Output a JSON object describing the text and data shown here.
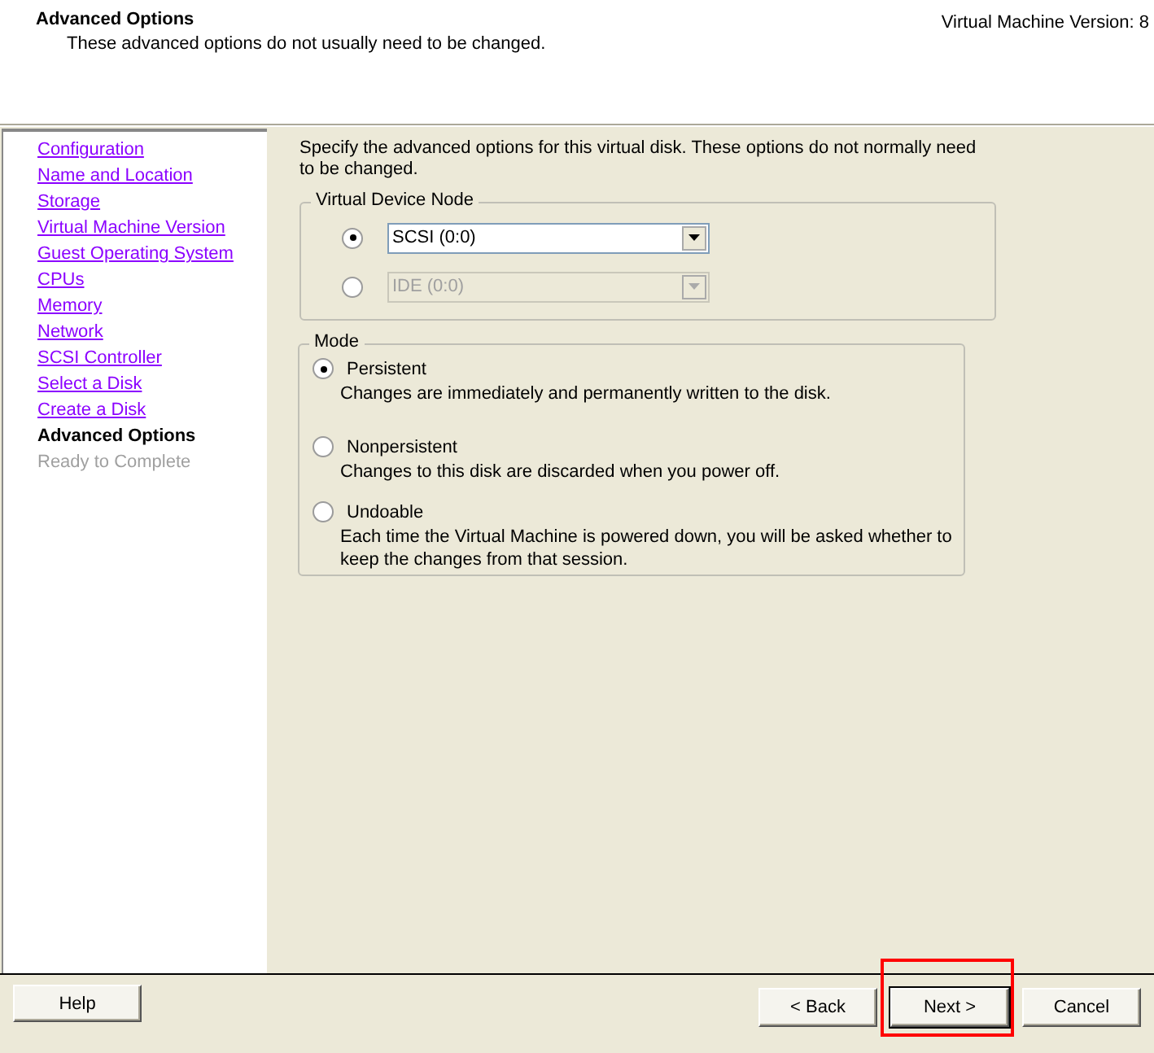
{
  "header": {
    "title": "Advanced Options",
    "subtitle": "These advanced options do not usually need to be changed.",
    "version": "Virtual Machine Version: 8"
  },
  "sidebar": {
    "items": [
      {
        "label": "Configuration",
        "kind": "link"
      },
      {
        "label": "Name and Location",
        "kind": "link"
      },
      {
        "label": "Storage",
        "kind": "link"
      },
      {
        "label": "Virtual Machine Version",
        "kind": "link"
      },
      {
        "label": "Guest Operating System",
        "kind": "link"
      },
      {
        "label": "CPUs",
        "kind": "link"
      },
      {
        "label": "Memory",
        "kind": "link"
      },
      {
        "label": "Network",
        "kind": "link"
      },
      {
        "label": "SCSI Controller",
        "kind": "link"
      },
      {
        "label": "Select a Disk",
        "kind": "link"
      },
      {
        "label": "Create a Disk",
        "kind": "link"
      },
      {
        "label": "Advanced Options",
        "kind": "current"
      },
      {
        "label": "Ready to Complete",
        "kind": "pending"
      }
    ]
  },
  "intro": "Specify the advanced options for this virtual disk. These options do not normally need to be changed.",
  "device_node": {
    "title": "Virtual Device Node",
    "options": [
      {
        "value": "SCSI (0:0)",
        "selected": true,
        "disabled": false
      },
      {
        "value": "IDE (0:0)",
        "selected": false,
        "disabled": true
      }
    ]
  },
  "mode": {
    "title": "Mode",
    "options": [
      {
        "label": "Persistent",
        "description": "Changes are immediately and permanently written to the disk.",
        "selected": true
      },
      {
        "label": "Nonpersistent",
        "description": "Changes to this disk are discarded when you power off.",
        "selected": false
      },
      {
        "label": "Undoable",
        "description": "Each time the Virtual Machine is powered down, you will be asked whether to keep the changes from that session.",
        "selected": false
      }
    ]
  },
  "buttons": {
    "help": "Help",
    "nav": [
      {
        "label": "< Back",
        "highlighted": false
      },
      {
        "label": "Next >",
        "highlighted": true
      },
      {
        "label": "Cancel",
        "highlighted": false
      }
    ]
  }
}
